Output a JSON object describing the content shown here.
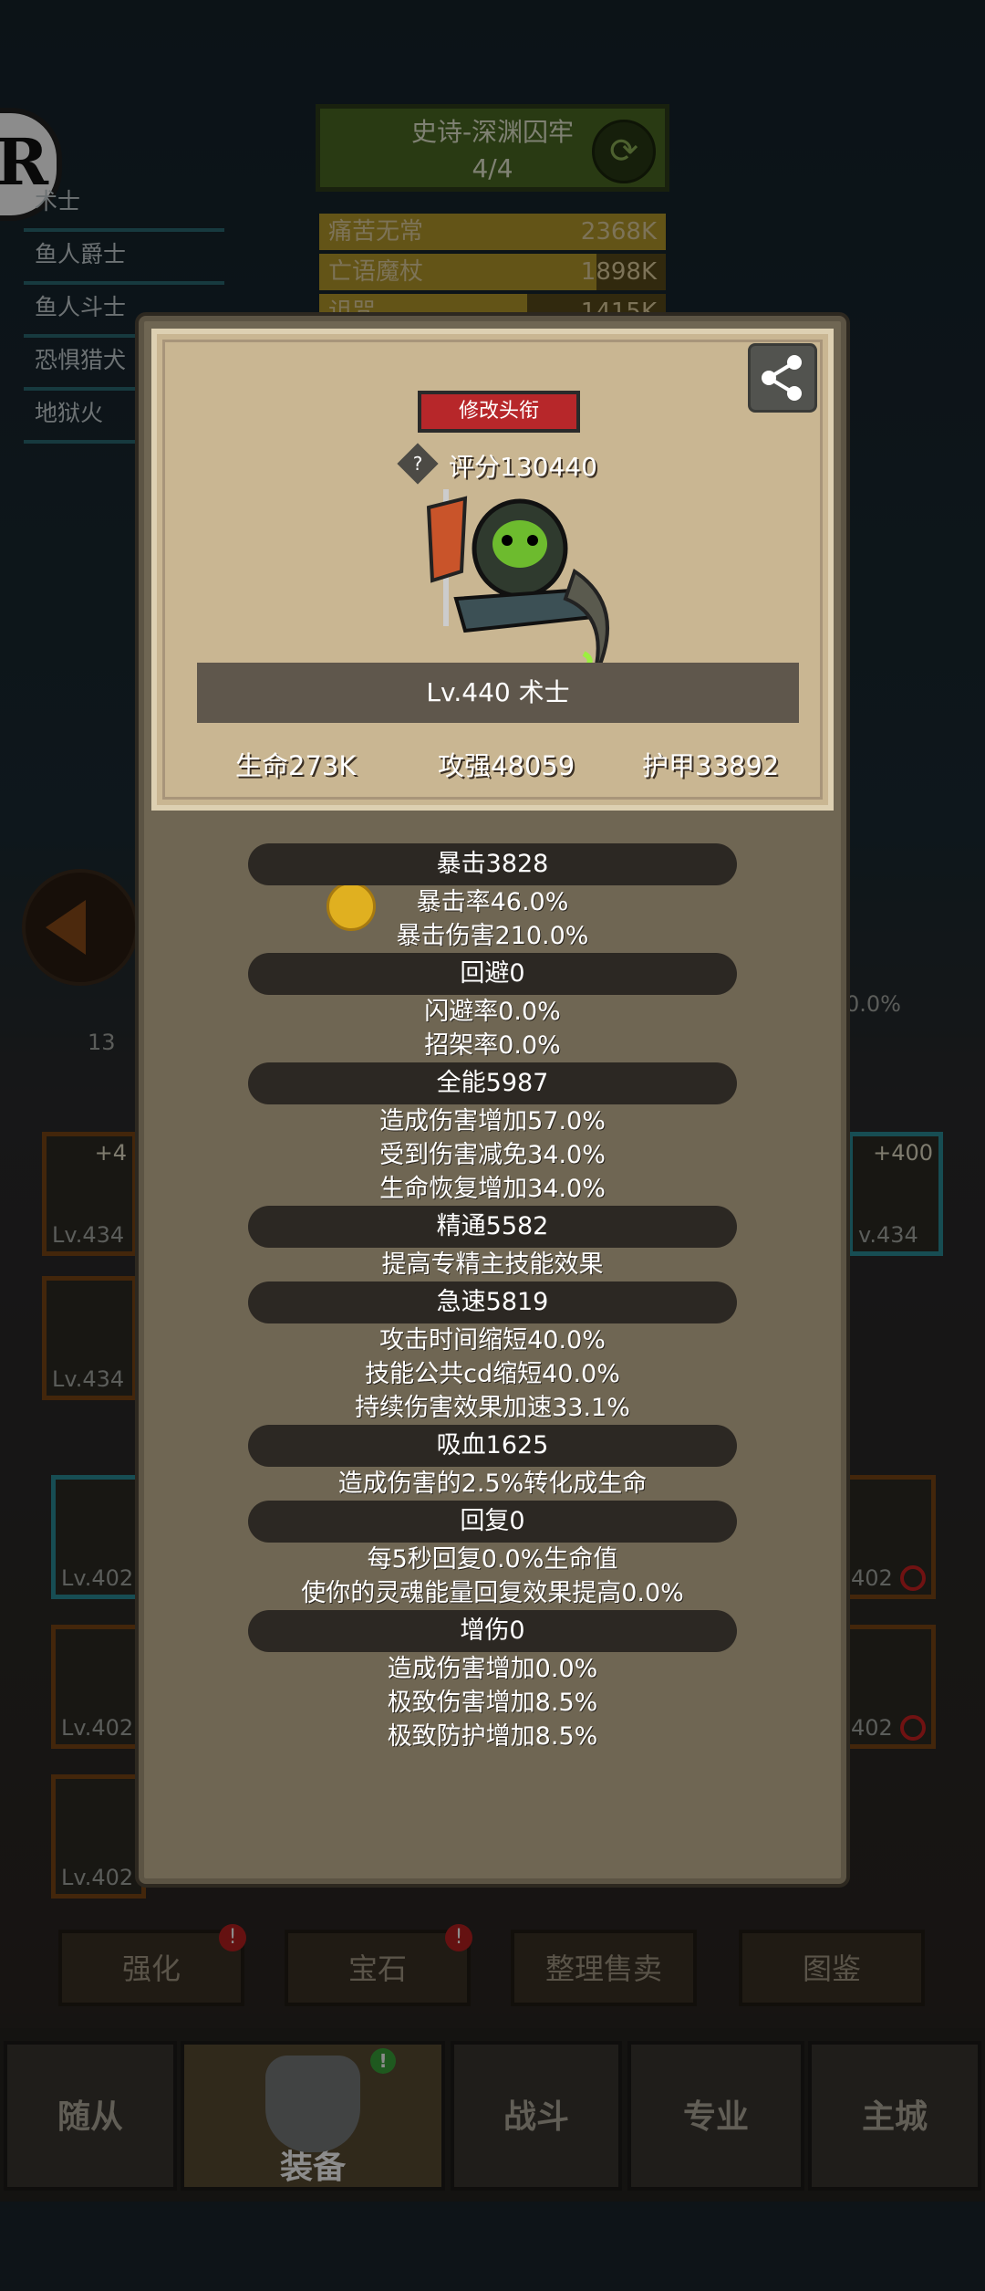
{
  "background": {
    "dungeon": {
      "title": "史诗-深渊囚牢",
      "progress": "4/4"
    },
    "team_list": [
      "术士",
      "鱼人爵士",
      "鱼人斗士",
      "恐惧猎犬",
      "地狱火"
    ],
    "damage_rows": [
      {
        "name": "痛苦无常",
        "value": "2368K",
        "fill": 1.0
      },
      {
        "name": "亡语魔杖",
        "value": "1898K",
        "fill": 0.8
      },
      {
        "name": "诅咒",
        "value": "1415K",
        "fill": 0.6
      }
    ],
    "side_pct": "0.0%",
    "level_13": "13",
    "equip_slots": [
      {
        "lv": "Lv.434",
        "plus": "+4"
      },
      {
        "lv": "Lv.434",
        "plus": ""
      },
      {
        "lv": "v.434",
        "plus": "+400"
      },
      {
        "lv": "Lv.402",
        "plus": ""
      },
      {
        "lv": "Lv.402",
        "plus": ""
      },
      {
        "lv": "Lv.402",
        "plus": ""
      },
      {
        "lv": "402",
        "plus": ""
      },
      {
        "lv": "402",
        "plus": ""
      }
    ],
    "actions": [
      {
        "label": "强化",
        "badge": "!"
      },
      {
        "label": "宝石",
        "badge": "!"
      },
      {
        "label": "整理售卖",
        "badge": ""
      },
      {
        "label": "图鉴",
        "badge": ""
      }
    ],
    "nav": [
      {
        "label": "随从"
      },
      {
        "label": "装备",
        "badge": "!"
      },
      {
        "label": "战斗"
      },
      {
        "label": "专业"
      },
      {
        "label": "主城"
      }
    ]
  },
  "modal": {
    "rename_label": "修改头衔",
    "help_icon": "?",
    "score": "评分130440",
    "level_line": "Lv.440 术士",
    "core_stats": {
      "hp": "生命273K",
      "atk": "攻强48059",
      "armor": "护甲33892"
    },
    "sections": [
      {
        "head": "暴击3828",
        "lines": [
          "暴击率46.0%",
          "暴击伤害210.0%"
        ]
      },
      {
        "head": "回避0",
        "lines": [
          "闪避率0.0%",
          "招架率0.0%"
        ]
      },
      {
        "head": "全能5987",
        "lines": [
          "造成伤害增加57.0%",
          "受到伤害减免34.0%",
          "生命恢复增加34.0%"
        ]
      },
      {
        "head": "精通5582",
        "lines": [
          "提高专精主技能效果"
        ]
      },
      {
        "head": "急速5819",
        "lines": [
          "攻击时间缩短40.0%",
          "技能公共cd缩短40.0%",
          "持续伤害效果加速33.1%"
        ]
      },
      {
        "head": "吸血1625",
        "lines": [
          "造成伤害的2.5%转化成生命"
        ]
      },
      {
        "head": "回复0",
        "lines": [
          "每5秒回复0.0%生命值",
          "使你的灵魂能量回复效果提高0.0%"
        ]
      },
      {
        "head": "增伤0",
        "lines": [
          "造成伤害增加0.0%",
          "极致伤害增加8.5%",
          "极致防护增加8.5%"
        ]
      }
    ]
  }
}
